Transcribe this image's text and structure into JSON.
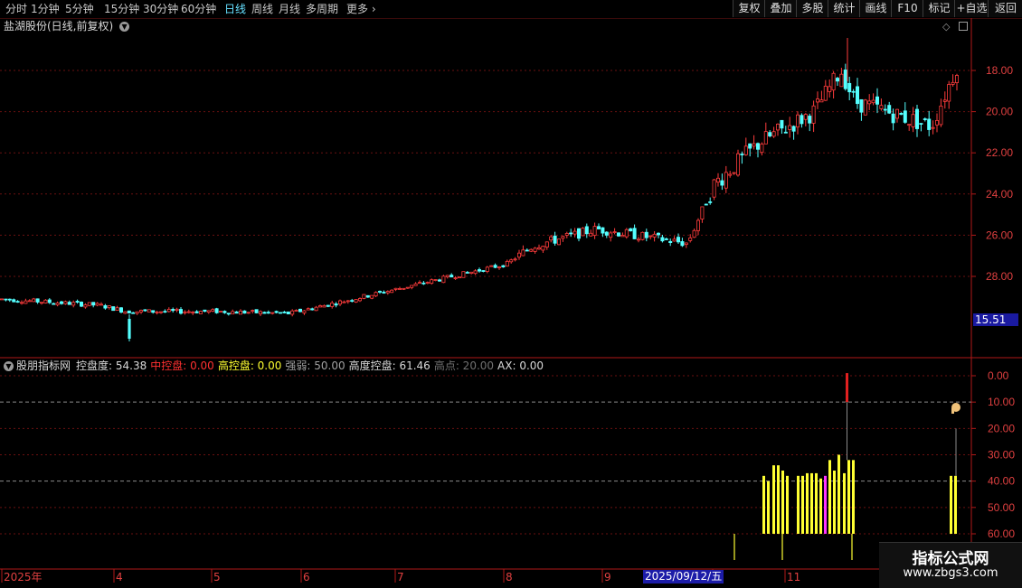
{
  "toolbar": {
    "periods": [
      "分时",
      "1分钟",
      "5分钟",
      "15分钟",
      "30分钟",
      "60分钟",
      "日线",
      "周线",
      "月线",
      "多周期",
      "更多"
    ],
    "active_period": "日线",
    "buttons": [
      "复权",
      "叠加",
      "多股",
      "统计",
      "画线",
      "F10",
      "标记",
      "+自选",
      "返回"
    ]
  },
  "price_panel": {
    "title": "盐湖股份(日线,前复权)",
    "y_ticks": [
      "28.00",
      "26.00",
      "24.00",
      "22.00",
      "20.00",
      "18.00"
    ],
    "last_price": "15.51"
  },
  "indicator_panel": {
    "name": "股朋指标网",
    "items": [
      {
        "label": "控盘度:",
        "value": "54.38",
        "color": "#d8d8d8"
      },
      {
        "label": "中控盘:",
        "value": "0.00",
        "color": "#ff3030"
      },
      {
        "label": "高控盘:",
        "value": "0.00",
        "color": "#ffff30"
      },
      {
        "label": "强弱:",
        "value": "50.00",
        "color": "#a0a0a0"
      },
      {
        "label": "高度控盘:",
        "value": "61.46",
        "color": "#d8d8d8"
      },
      {
        "label": "高点:",
        "value": "20.00",
        "color": "#707070"
      },
      {
        "label": "AX:",
        "value": "0.00",
        "color": "#d8d8d8"
      }
    ],
    "y_ticks": [
      "60.00",
      "50.00",
      "40.00",
      "30.00",
      "20.00",
      "10.00",
      "0.00"
    ]
  },
  "date_axis": {
    "labels": [
      "2025年",
      "4",
      "5",
      "6",
      "7",
      "8",
      "9",
      "0",
      "11"
    ],
    "cursor_date": "2025/09/12/五"
  },
  "watermark": {
    "title": "指标公式网",
    "url": "www.zbgs3.com"
  },
  "colors": {
    "up": "#ff3c3c",
    "down": "#54ffff",
    "grid": "#6a1010",
    "bar_yellow": "#ffff33",
    "bar_magenta": "#ff33ff"
  },
  "chart_data": [
    {
      "type": "candlestick",
      "title": "盐湖股份(日线,前复权)",
      "ylim": [
        15.5,
        29.5
      ],
      "yticks": [
        18,
        20,
        22,
        24,
        26,
        28
      ],
      "close_trend": [
        {
          "x": "2025-01",
          "y": 16.9
        },
        {
          "x": "2025-03",
          "y": 16.6
        },
        {
          "x": "2025-04",
          "y": 16.3
        },
        {
          "x": "2025-05",
          "y": 16.3
        },
        {
          "x": "2025-06",
          "y": 16.2
        },
        {
          "x": "2025-07",
          "y": 17.4
        },
        {
          "x": "2025-08",
          "y": 18.6
        },
        {
          "x": "2025-08-20",
          "y": 19.5
        },
        {
          "x": "2025-09",
          "y": 20.3
        },
        {
          "x": "2025-09-25",
          "y": 19.6
        },
        {
          "x": "2025-10-10",
          "y": 22.5
        },
        {
          "x": "2025-10-20",
          "y": 24.5
        },
        {
          "x": "2025-11-05",
          "y": 26.0
        },
        {
          "x": "2025-11-15",
          "y": 28.0
        },
        {
          "x": "2025-11-20",
          "y": 26.5
        },
        {
          "x": "2025-12",
          "y": 25.3
        },
        {
          "x": "2025-12-15",
          "y": 28.2
        }
      ]
    },
    {
      "type": "bar",
      "title": "股朋指标网",
      "ylim": [
        0,
        65
      ],
      "yticks": [
        0,
        10,
        20,
        30,
        40,
        50,
        60
      ],
      "series": [
        {
          "name": "控盘度",
          "values": [
            22,
            20,
            26,
            26,
            24,
            22,
            22,
            22,
            23,
            23,
            23,
            21,
            22,
            28,
            24,
            30,
            23,
            28,
            28,
            22,
            22
          ]
        }
      ]
    }
  ]
}
